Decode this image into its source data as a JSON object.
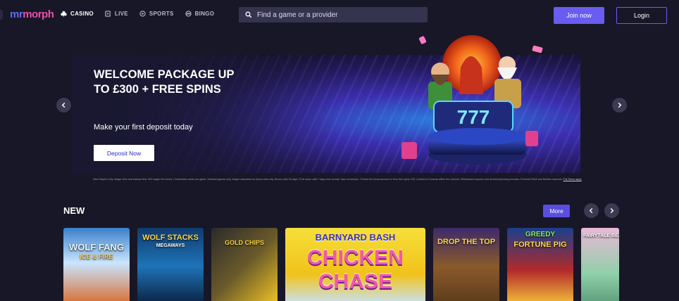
{
  "header": {
    "logo_part1": "mr",
    "logo_part2": "morph",
    "nav": [
      {
        "label": "CASINO",
        "icon": "club-icon",
        "active": true
      },
      {
        "label": "LIVE",
        "icon": "live-icon",
        "active": false
      },
      {
        "label": "SPORTS",
        "icon": "football-icon",
        "active": false
      },
      {
        "label": "BINGO",
        "icon": "bingo-icon",
        "active": false
      }
    ],
    "search_placeholder": "Find a game or a provider",
    "join_label": "Join now",
    "login_label": "Login"
  },
  "hero": {
    "title": "WELCOME PACKAGE UP TO £300 + FREE SPINS",
    "subtitle": "Make your first deposit today",
    "cta_label": "Deposit Now",
    "terms": "New Players Only. Wager from real balance first. 50X wager the bonus. Contribution varies per game. Selected games only. Wager calculated on bonus bets only. Bonus valid 30 days / Free spins valid 7 days from receipt. Max conversion: 3 times the bonus amount or from free spins: £20. Limited to 5 brands within the network. Withdrawal requests void all active/pending bonuses. Excluded Skrill and Neteller deposits.",
    "terms_link": "Full Terms apply",
    "reel_digits": "777"
  },
  "new_section": {
    "title": "NEW",
    "more_label": "More",
    "games": [
      {
        "title": "WOLF FANG",
        "subtitle": "ICE & FIRE"
      },
      {
        "title": "WOLF STACKS",
        "subtitle": "MEGAWAYS"
      },
      {
        "title": "GOLD CHIPS",
        "subtitle": ""
      },
      {
        "title": "BARNYARD BASH",
        "subtitle": "CHICKEN CHASE"
      },
      {
        "title": "DROP THE TOP",
        "subtitle": ""
      },
      {
        "title": "GREEDY",
        "subtitle": "FORTUNE PIG"
      },
      {
        "title": "FAIRYTALE BEAUTY",
        "subtitle": ""
      }
    ]
  },
  "colors": {
    "background": "#181727",
    "accent": "#6a5cf0",
    "search_bg": "#34344f"
  }
}
